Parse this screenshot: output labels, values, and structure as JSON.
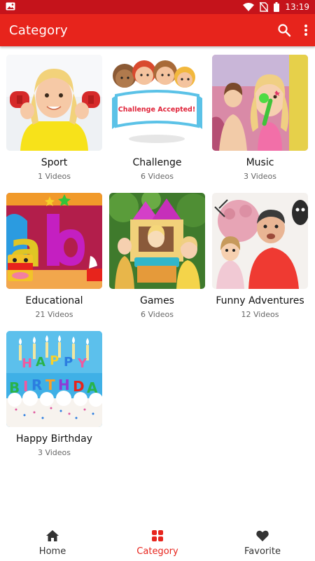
{
  "status_bar": {
    "time": "13:19",
    "left_icon": "gallery-icon",
    "right_icons": [
      "wifi-icon",
      "no-sim-icon",
      "battery-icon"
    ]
  },
  "app_bar": {
    "title": "Category",
    "search_icon": "search-icon",
    "menu_icon": "more-vert-icon"
  },
  "categories": [
    {
      "name": "Sport",
      "count": "1 Videos"
    },
    {
      "name": "Challenge",
      "count": "6 Videos",
      "banner_text": "Challenge Accepted!"
    },
    {
      "name": "Music",
      "count": "3 Videos"
    },
    {
      "name": "Educational",
      "count": "21 Videos"
    },
    {
      "name": "Games",
      "count": "6 Videos"
    },
    {
      "name": "Funny Adventures",
      "count": "12 Videos"
    },
    {
      "name": "Happy Birthday",
      "count": "3 Videos"
    }
  ],
  "bottom_nav": {
    "items": [
      {
        "label": "Home",
        "icon": "home-icon",
        "active": false
      },
      {
        "label": "Category",
        "icon": "grid-icon",
        "active": true
      },
      {
        "label": "Favorite",
        "icon": "heart-icon",
        "active": false
      }
    ]
  },
  "colors": {
    "status_bar": "#c5131b",
    "app_bar": "#e7241c",
    "active_nav": "#e7241c",
    "inactive_nav": "#333333"
  }
}
